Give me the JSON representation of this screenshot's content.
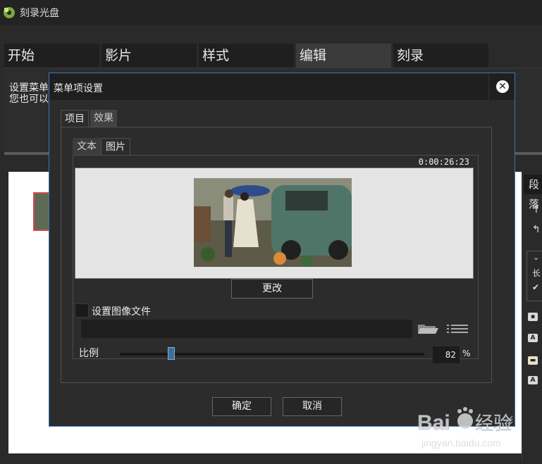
{
  "app": {
    "title": "刻录光盘"
  },
  "main_tabs": [
    {
      "label": "开始"
    },
    {
      "label": "影片"
    },
    {
      "label": "样式"
    },
    {
      "label": "编辑"
    },
    {
      "label": "刻录"
    }
  ],
  "info": {
    "line1": "设置菜单",
    "line2": "您也可以"
  },
  "right_panel": {
    "tab_label": "段落"
  },
  "dialog": {
    "title": "菜单项设置",
    "tabs": [
      {
        "label": "项目"
      },
      {
        "label": "效果"
      }
    ],
    "inner_tabs": [
      {
        "label": "文本"
      },
      {
        "label": "图片"
      }
    ],
    "timecode": "0:00:26:23",
    "change_button": "更改",
    "set_image_label": "设置图像文件",
    "scale_label": "比例",
    "scale_value": "82",
    "scale_unit": "%",
    "ok_button": "确定",
    "cancel_button": "取消"
  },
  "watermark": {
    "brand": "Baidu经验",
    "url": "jingyan.baidu.com"
  }
}
